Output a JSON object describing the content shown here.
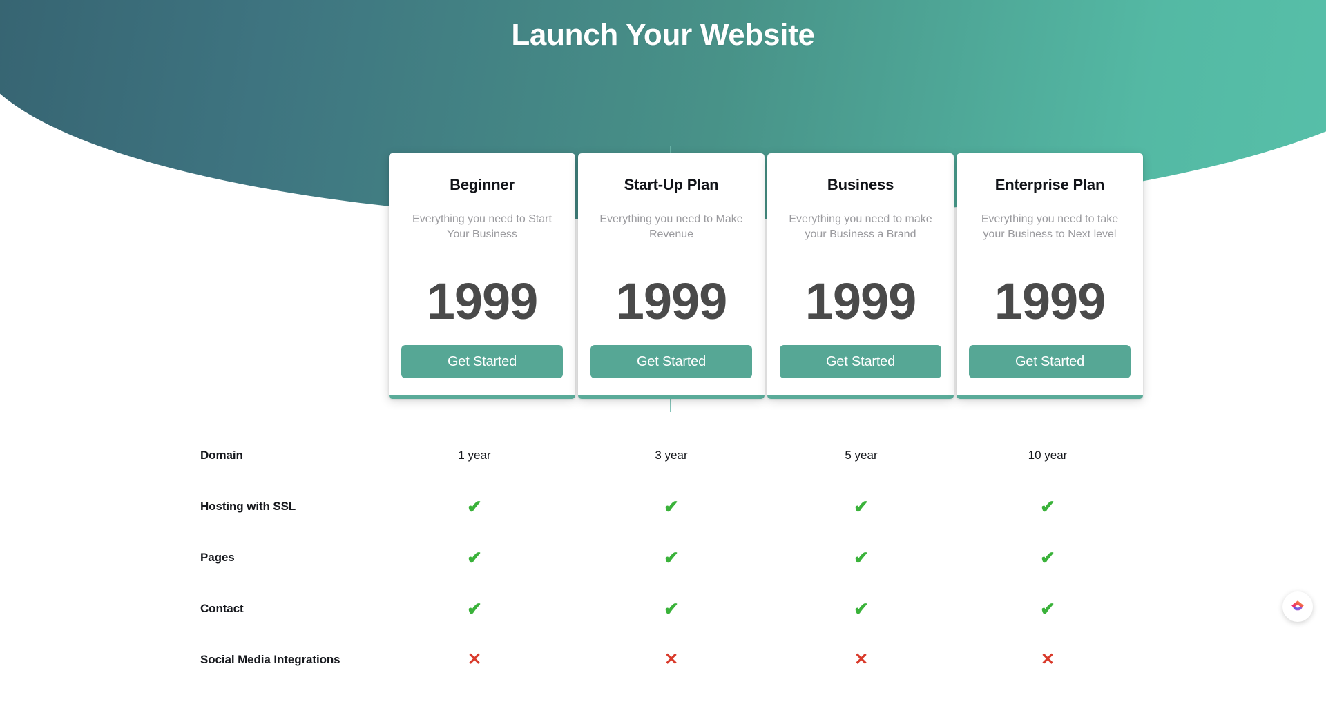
{
  "hero": {
    "title": "Launch Your Website",
    "gradient_from": "#35616f",
    "gradient_to": "#58c3ab"
  },
  "accent_color": "#56a795",
  "plans": [
    {
      "name": "Beginner",
      "description": "Everything you need to Start Your Business",
      "price": "1999",
      "cta": "Get Started"
    },
    {
      "name": "Start-Up Plan",
      "description": "Everything you need to Make Revenue",
      "price": "1999",
      "cta": "Get Started"
    },
    {
      "name": "Business",
      "description": "Everything you need to make your Business a Brand",
      "price": "1999",
      "cta": "Get Started"
    },
    {
      "name": "Enterprise Plan",
      "description": "Everything you need to take your Business to Next level",
      "price": "1999",
      "cta": "Get Started"
    }
  ],
  "comparison": {
    "rows": [
      {
        "feature": "Domain",
        "values": [
          "1 year",
          "3 year",
          "5 year",
          "10 year"
        ]
      },
      {
        "feature": "Hosting with SSL",
        "values": [
          "yes",
          "yes",
          "yes",
          "yes"
        ]
      },
      {
        "feature": "Pages",
        "values": [
          "yes",
          "yes",
          "yes",
          "yes"
        ]
      },
      {
        "feature": "Contact",
        "values": [
          "yes",
          "yes",
          "yes",
          "yes"
        ]
      },
      {
        "feature": "Social Media Integrations",
        "values": [
          "no",
          "no",
          "no",
          "no"
        ]
      }
    ],
    "yes_glyph": "✔",
    "no_glyph": "✕",
    "yes_color": "#3ab23a",
    "no_color": "#d93a2b"
  },
  "badge": {
    "icon": "clickup-logo-icon"
  }
}
